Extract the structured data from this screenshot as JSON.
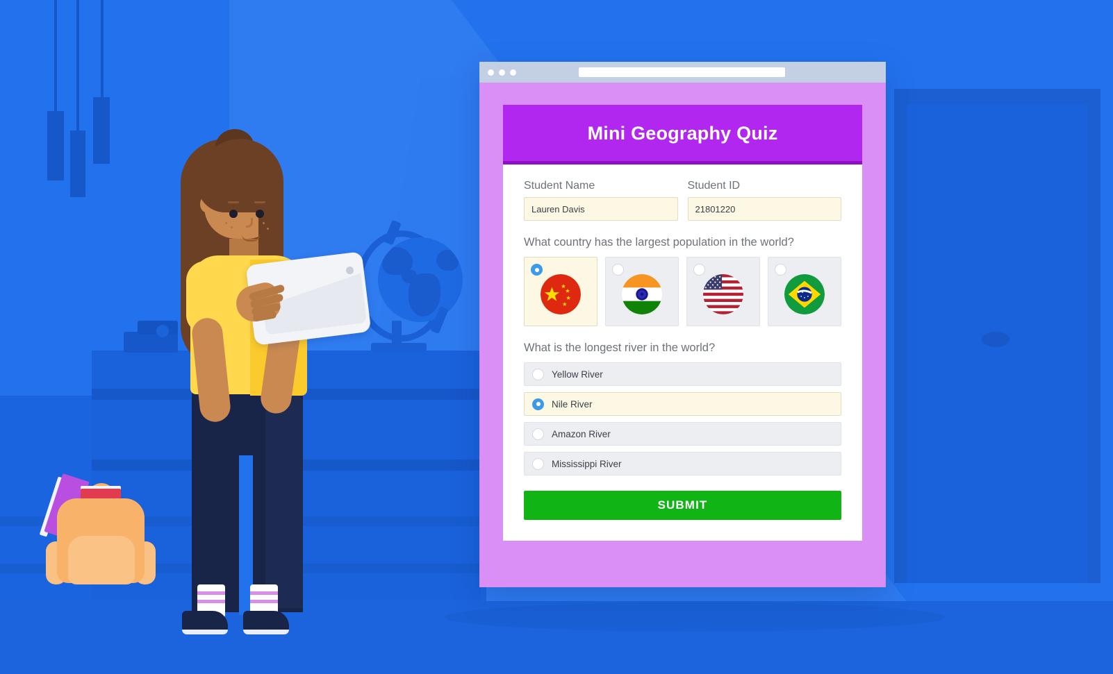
{
  "browser": {
    "window_controls": [
      "close-dot",
      "minimize-dot",
      "maximize-dot"
    ],
    "address_bar_value": ""
  },
  "quiz": {
    "title": "Mini Geography Quiz",
    "fields": [
      {
        "label": "Student Name",
        "value": "Lauren Davis",
        "placeholder": "Student Name"
      },
      {
        "label": "Student ID",
        "value": "21801220",
        "placeholder": "Student ID"
      }
    ],
    "question1": {
      "text": "What country has the largest population in the world?",
      "options": [
        {
          "name": "China",
          "icon": "flag-china-icon",
          "selected": true
        },
        {
          "name": "India",
          "icon": "flag-india-icon",
          "selected": false
        },
        {
          "name": "United States",
          "icon": "flag-usa-icon",
          "selected": false
        },
        {
          "name": "Brazil",
          "icon": "flag-brazil-icon",
          "selected": false
        }
      ]
    },
    "question2": {
      "text": "What is the longest river in the world?",
      "options": [
        {
          "label": "Yellow River",
          "selected": false
        },
        {
          "label": "Nile River",
          "selected": true
        },
        {
          "label": "Amazon River",
          "selected": false
        },
        {
          "label": "Mississippi River",
          "selected": false
        }
      ]
    },
    "submit_label": "SUBMIT"
  },
  "illustration": {
    "scene_items": [
      "pendant-lamps",
      "door",
      "cabinet",
      "globe",
      "student-girl",
      "tablet",
      "backpack",
      "books"
    ]
  },
  "colors": {
    "background_blue": "#2272ee",
    "header_purple": "#b227ef",
    "header_purple_dark": "#8f0fc4",
    "frame_purple": "#d98ff5",
    "submit_green": "#11b415",
    "selected_cream": "#fcf8e3",
    "option_grey": "#eceef2",
    "radio_blue": "#3d9ae8",
    "shirt_yellow": "#ffd84d",
    "pants_navy": "#182448",
    "backpack_orange": "#f9b26a"
  }
}
